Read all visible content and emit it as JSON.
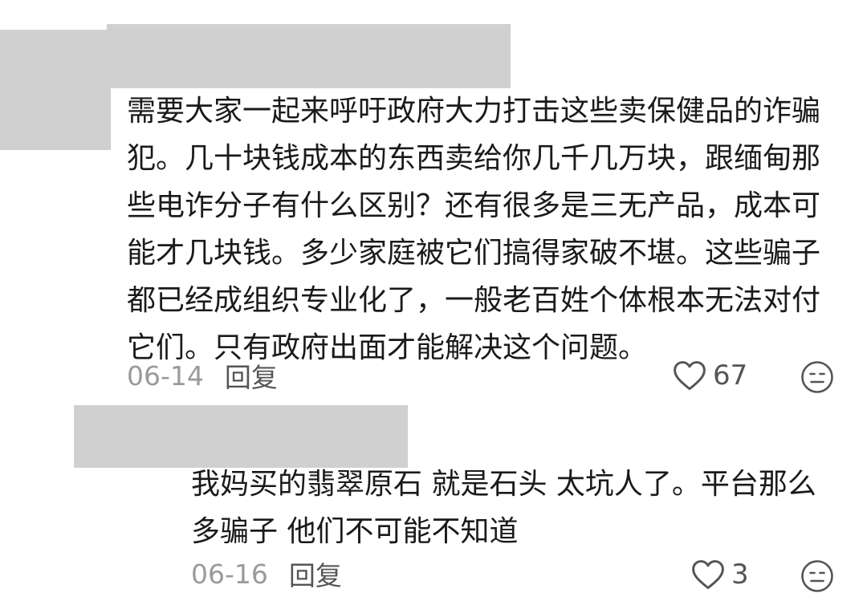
{
  "comments": [
    {
      "text": "需要大家一起来呼吁政府大力打击这些卖保健品的诈骗犯。几十块钱成本的东西卖给你几千几万块，跟缅甸那些电诈分子有什么区别？还有很多是三无产品，成本可能才几块钱。多少家庭被它们搞得家破不堪。这些骗子都已经成组织专业化了，一般老百姓个体根本无法对付它们。只有政府出面才能解决这个问题。",
      "date": "06-14",
      "reply_label": "回复",
      "likes": "67"
    },
    {
      "text": "我妈买的翡翠原石 就是石头 太坑人了。平台那么多骗子 他们不可能不知道",
      "date": "06-16",
      "reply_label": "回复",
      "likes": "3"
    }
  ],
  "icons": {
    "like": "heart-outline-icon",
    "emoji": "emoji-face-icon"
  },
  "colors": {
    "redaction": "#d0d0d0",
    "text": "#1a1a1a",
    "meta": "#9a9a9a",
    "action": "#555555"
  }
}
